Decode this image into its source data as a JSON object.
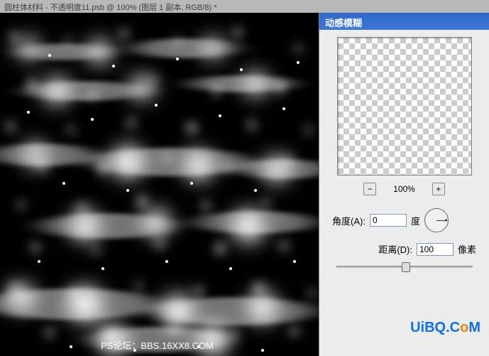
{
  "window": {
    "title": "圆柱体材料 - 不透明度11.psb @ 100% (图层 1 副本, RGB/8) *"
  },
  "dialog": {
    "title": "动感模糊",
    "zoom": {
      "minus": "−",
      "plus": "+",
      "level": "100%"
    },
    "angle": {
      "label": "角度(A):",
      "value": "0",
      "unit": "度"
    },
    "distance": {
      "label": "距离(D):",
      "value": "100",
      "unit": "像素"
    }
  },
  "watermarks": {
    "footer": "PS论坛：BBS.16XX8.COM",
    "brand_prefix": "UiBQ.C",
    "brand_o": "o",
    "brand_suffix": "M"
  }
}
